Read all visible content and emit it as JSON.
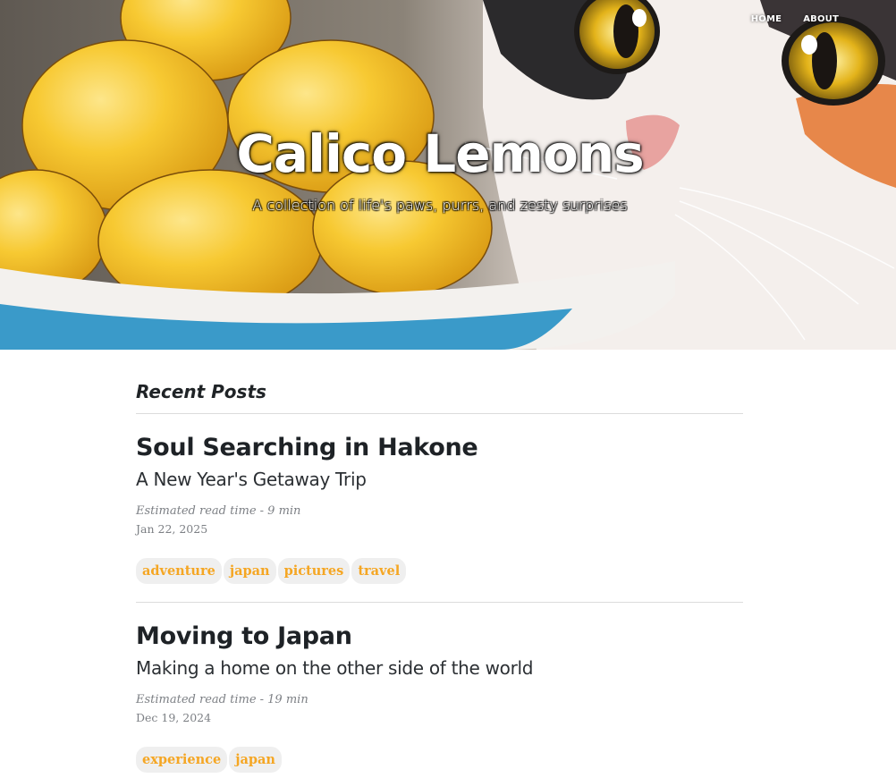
{
  "nav": {
    "home": "HOME",
    "about": "ABOUT"
  },
  "hero": {
    "title": "Calico Lemons",
    "subtitle": "A collection of life's paws, purrs, and zesty surprises"
  },
  "main": {
    "section_title": "Recent Posts",
    "posts": [
      {
        "title": "Soul Searching in Hakone",
        "subtitle": "A New Year's Getaway Trip",
        "read_time": "Estimated read time - 9 min",
        "date": "Jan 22, 2025",
        "tags": [
          "adventure",
          "japan",
          "pictures",
          "travel"
        ]
      },
      {
        "title": "Moving to Japan",
        "subtitle": "Making a home on the other side of the world",
        "read_time": "Estimated read time - 19 min",
        "date": "Dec 19, 2024",
        "tags": [
          "experience",
          "japan"
        ]
      }
    ]
  },
  "colors": {
    "tag_text": "#f5a623",
    "tag_bg": "#efefef",
    "lemon": "#f5c531",
    "bowl_blue": "#3a9ac9"
  }
}
